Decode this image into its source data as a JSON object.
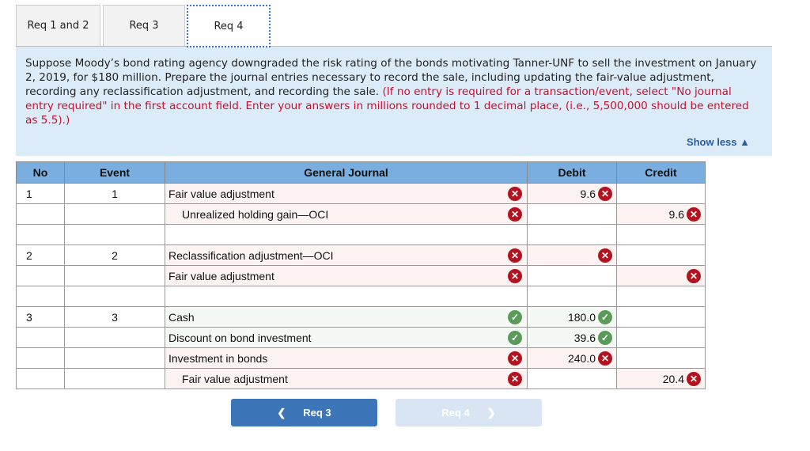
{
  "tabs": [
    {
      "label": "Req 1 and 2"
    },
    {
      "label": "Req 3"
    },
    {
      "label": "Req 4"
    }
  ],
  "instructions": {
    "main": "Suppose Moody’s bond rating agency downgraded the risk rating of the bonds motivating Tanner-UNF to sell the investment on January 2, 2019, for $180 million. Prepare the journal entries necessary to record the sale, including updating the fair-value adjustment, recording any reclassification adjustment, and recording the sale.",
    "note": "(If no entry is required for a transaction/event, select \"No journal entry required\" in the first account field. Enter your answers in millions rounded to 1 decimal place, (i.e., 5,500,000 should be entered as 5.5).)",
    "show_less": "Show less ▲"
  },
  "table": {
    "headers": [
      "No",
      "Event",
      "General Journal",
      "Debit",
      "Credit"
    ],
    "rows": [
      {
        "no": "1",
        "event": "1",
        "account": "Fair value adjustment",
        "indent": false,
        "acct_status": "wrong",
        "debit": "9.6",
        "debit_status": "wrong",
        "credit": "",
        "credit_status": ""
      },
      {
        "no": "",
        "event": "",
        "account": "Unrealized holding gain—OCI",
        "indent": true,
        "acct_status": "wrong",
        "debit": "",
        "debit_status": "",
        "credit": "9.6",
        "credit_status": "wrong"
      },
      {
        "no": "",
        "event": "",
        "account": "",
        "indent": false,
        "acct_status": "",
        "debit": "",
        "debit_status": "",
        "credit": "",
        "credit_status": ""
      },
      {
        "no": "2",
        "event": "2",
        "account": "Reclassification adjustment—OCI",
        "indent": false,
        "acct_status": "wrong",
        "debit": "",
        "debit_status": "wrong",
        "credit": "",
        "credit_status": ""
      },
      {
        "no": "",
        "event": "",
        "account": "Fair value adjustment",
        "indent": false,
        "acct_status": "wrong",
        "debit": "",
        "debit_status": "",
        "credit": "",
        "credit_status": "wrong"
      },
      {
        "no": "",
        "event": "",
        "account": "",
        "indent": false,
        "acct_status": "",
        "debit": "",
        "debit_status": "",
        "credit": "",
        "credit_status": ""
      },
      {
        "no": "3",
        "event": "3",
        "account": "Cash",
        "indent": false,
        "acct_status": "correct",
        "debit": "180.0",
        "debit_status": "correct",
        "credit": "",
        "credit_status": ""
      },
      {
        "no": "",
        "event": "",
        "account": "Discount on bond investment",
        "indent": false,
        "acct_status": "correct",
        "debit": "39.6",
        "debit_status": "correct",
        "credit": "",
        "credit_status": ""
      },
      {
        "no": "",
        "event": "",
        "account": "Investment in bonds",
        "indent": false,
        "acct_status": "wrong",
        "debit": "240.0",
        "debit_status": "wrong",
        "credit": "",
        "credit_status": ""
      },
      {
        "no": "",
        "event": "",
        "account": "Fair value adjustment",
        "indent": true,
        "acct_status": "wrong",
        "debit": "",
        "debit_status": "",
        "credit": "20.4",
        "credit_status": "wrong"
      }
    ]
  },
  "nav": {
    "prev_label": "Req 3",
    "next_label": "Req 4"
  },
  "colors": {
    "accent": "#3d76b8",
    "header": "#7aaee0",
    "wrong": "#b3121f",
    "correct": "#5a9b5a"
  }
}
